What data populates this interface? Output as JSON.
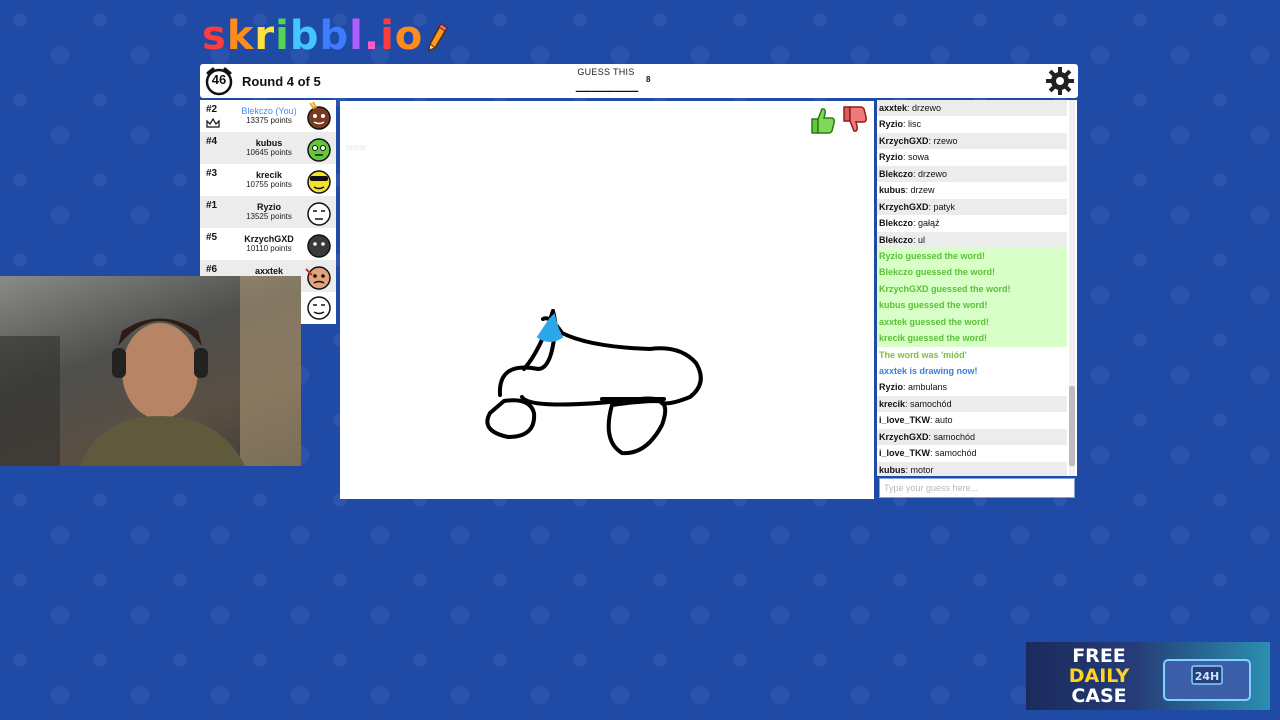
{
  "logo": {
    "text": "skribbl.io"
  },
  "topbar": {
    "timer": "46",
    "round": "Round 4 of 5",
    "guess_label": "GUESS THIS",
    "word_blanks": "________",
    "word_length": "8"
  },
  "players": [
    {
      "rank": "#2",
      "name": "Blekczo (You)",
      "points": "13375 points",
      "is_you": true
    },
    {
      "rank": "#4",
      "name": "kubus",
      "points": "10645 points"
    },
    {
      "rank": "#3",
      "name": "krecik",
      "points": "10755 points"
    },
    {
      "rank": "#1",
      "name": "Ryzio",
      "points": "13525 points"
    },
    {
      "rank": "#5",
      "name": "KrzychGXD",
      "points": "10110 points"
    },
    {
      "rank": "#6",
      "name": "axxtek",
      "points": ""
    }
  ],
  "canvas": {
    "ghost_text": "motor"
  },
  "chat": {
    "messages": [
      {
        "user": "axxtek",
        "text": "drzewo",
        "style": "alt"
      },
      {
        "user": "Ryzio",
        "text": "lisc",
        "style": "plain"
      },
      {
        "user": "KrzychGXD",
        "text": "rzewo",
        "style": "alt"
      },
      {
        "user": "Ryzio",
        "text": "sowa",
        "style": "plain"
      },
      {
        "user": "Blekczo",
        "text": "drzewo",
        "style": "alt"
      },
      {
        "user": "kubus",
        "text": "drzew",
        "style": "plain"
      },
      {
        "user": "KrzychGXD",
        "text": "patyk",
        "style": "alt"
      },
      {
        "user": "Blekczo",
        "text": "gałąź",
        "style": "plain"
      },
      {
        "user": "Blekczo",
        "text": "ul",
        "style": "alt"
      },
      {
        "user": "",
        "text": "Ryzio guessed the word!",
        "style": "green"
      },
      {
        "user": "",
        "text": "Blekczo guessed the word!",
        "style": "green"
      },
      {
        "user": "",
        "text": "KrzychGXD guessed the word!",
        "style": "green"
      },
      {
        "user": "",
        "text": "kubus guessed the word!",
        "style": "green"
      },
      {
        "user": "",
        "text": "axxtek guessed the word!",
        "style": "green"
      },
      {
        "user": "",
        "text": "krecik guessed the word!",
        "style": "green"
      },
      {
        "user": "",
        "text": "The word was 'miód'",
        "style": "yellowish"
      },
      {
        "user": "",
        "text": "axxtek is drawing now!",
        "style": "blue"
      },
      {
        "user": "Ryzio",
        "text": "ambulans",
        "style": "plain"
      },
      {
        "user": "krecik",
        "text": "samochód",
        "style": "alt"
      },
      {
        "user": "i_love_TKW",
        "text": "auto",
        "style": "plain"
      },
      {
        "user": "KrzychGXD",
        "text": "samochód",
        "style": "alt"
      },
      {
        "user": "i_love_TKW",
        "text": "samochód",
        "style": "plain"
      },
      {
        "user": "kubus",
        "text": "motor",
        "style": "alt"
      }
    ],
    "input_placeholder": "Type your guess here..."
  },
  "promo": {
    "line1": "FREE",
    "line2": "DAILY",
    "line3": "CASE",
    "badge": "24H"
  }
}
